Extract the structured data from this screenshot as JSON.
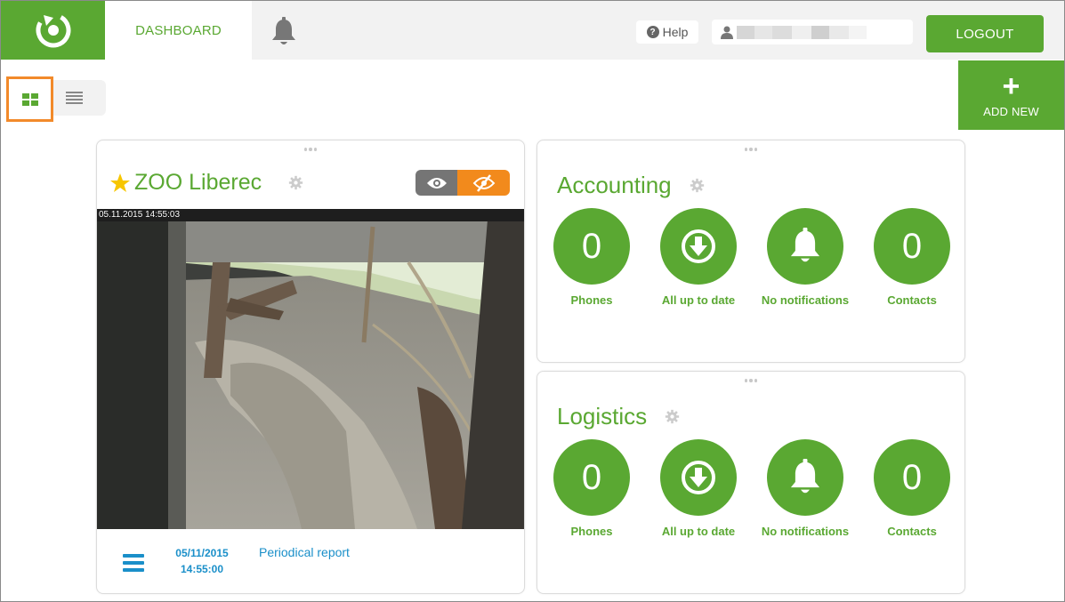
{
  "header": {
    "dashboard_tab": "DASHBOARD",
    "help_label": "Help",
    "logout_label": "LOGOUT"
  },
  "toolbar": {
    "add_new_label": "ADD NEW"
  },
  "zoo": {
    "title": "ZOO Liberec",
    "camera_timestamp": "05.11.2015 14:55:03",
    "footer_date": "05/11/2015",
    "footer_time": "14:55:00",
    "footer_report": "Periodical report"
  },
  "accounting": {
    "title": "Accounting",
    "stats": [
      {
        "value": "0",
        "label": "Phones"
      },
      {
        "value": "",
        "label": "All up to date"
      },
      {
        "value": "",
        "label": "No notifications"
      },
      {
        "value": "0",
        "label": "Contacts"
      }
    ]
  },
  "logistics": {
    "title": "Logistics",
    "stats": [
      {
        "value": "0",
        "label": "Phones"
      },
      {
        "value": "",
        "label": "All up to date"
      },
      {
        "value": "",
        "label": "No notifications"
      },
      {
        "value": "0",
        "label": "Contacts"
      }
    ]
  },
  "colors": {
    "brand_green": "#5aa832",
    "accent_orange": "#f28a1c",
    "link_blue": "#1a8fc9"
  }
}
